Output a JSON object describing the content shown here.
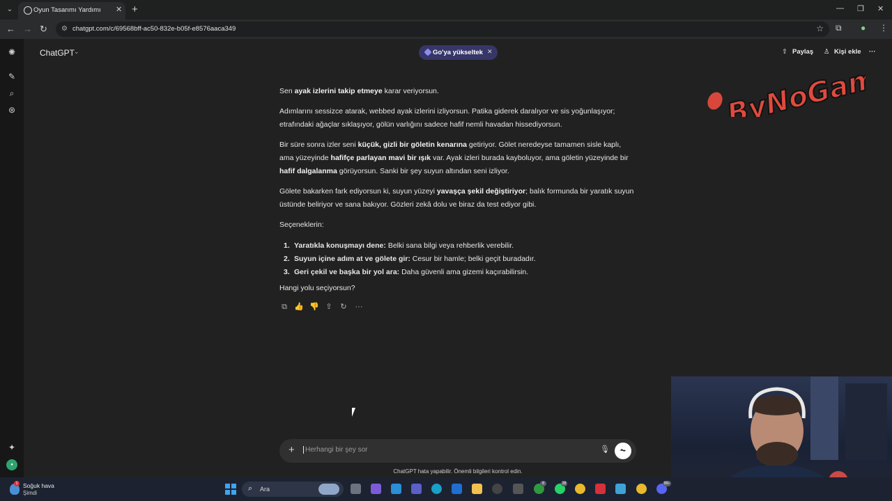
{
  "browser": {
    "tab_title": "Oyun Tasarımı Yardımı",
    "url": "chatgpt.com/c/69568bff-ac50-832e-b05f-e8576aaca349"
  },
  "header": {
    "brand": "ChatGPT",
    "upgrade_label": "Go'ya yükseltek",
    "share_label": "Paylaş",
    "add_person_label": "Kişi ekle"
  },
  "watermark_text": "ByNoGame",
  "message": {
    "p1": {
      "pre": "Sen ",
      "b1": "ayak izlerini takip etmeye",
      "post": " karar veriyorsun."
    },
    "p2": "Adımlarını sessizce atarak, webbed ayak izlerini izliyorsun. Patika giderek daralıyor ve sis yoğunlaşıyor; etrafındaki ağaçlar sıklaşıyor, gölün varlığını sadece hafif nemli havadan hissediyorsun.",
    "p3": {
      "pre": "Bir süre sonra izler seni ",
      "b1": "küçük, gizli bir göletin kenarına",
      "mid1": " getiriyor. Gölet neredeyse tamamen sisle kaplı, ama yüzeyinde ",
      "b2": "hafifçe parlayan mavi bir ışık",
      "mid2": " var. Ayak izleri burada kayboluyor, ama göletin yüzeyinde bir ",
      "b3": "hafif dalgalanma",
      "post": " görüyorsun. Sanki bir şey suyun altından seni izliyor."
    },
    "p4": {
      "pre": "Gölete bakarken fark ediyorsun ki, suyun yüzeyi ",
      "b1": "yavaşça şekil değiştiriyor",
      "post": "; balık formunda bir yaratık suyun üstünde beliriyor ve sana bakıyor. Gözleri zekâ dolu ve biraz da test ediyor gibi."
    },
    "options_title": "Seçeneklerin:",
    "options": [
      {
        "num": "1.",
        "bold": "Yaratıkla konuşmayı dene:",
        "text": " Belki sana bilgi veya rehberlik verebilir."
      },
      {
        "num": "2.",
        "bold": "Suyun içine adım at ve gölete gir:",
        "text": " Cesur bir hamle; belki geçit buradadır."
      },
      {
        "num": "3.",
        "bold": "Geri çekil ve başka bir yol ara:",
        "text": " Daha güvenli ama gizemi kaçırabilirsin."
      }
    ],
    "question": "Hangi yolu seçiyorsun?"
  },
  "composer": {
    "placeholder": "Herhangi bir şey sor",
    "disclaimer": "ChatGPT hata yapabilir. Önemli bilgileri kontrol edin."
  },
  "taskbar": {
    "weather_title": "Soğuk hava",
    "weather_sub": "Şimdi",
    "search_label": "Ara",
    "badges": [
      "8",
      "28",
      "99+"
    ]
  }
}
